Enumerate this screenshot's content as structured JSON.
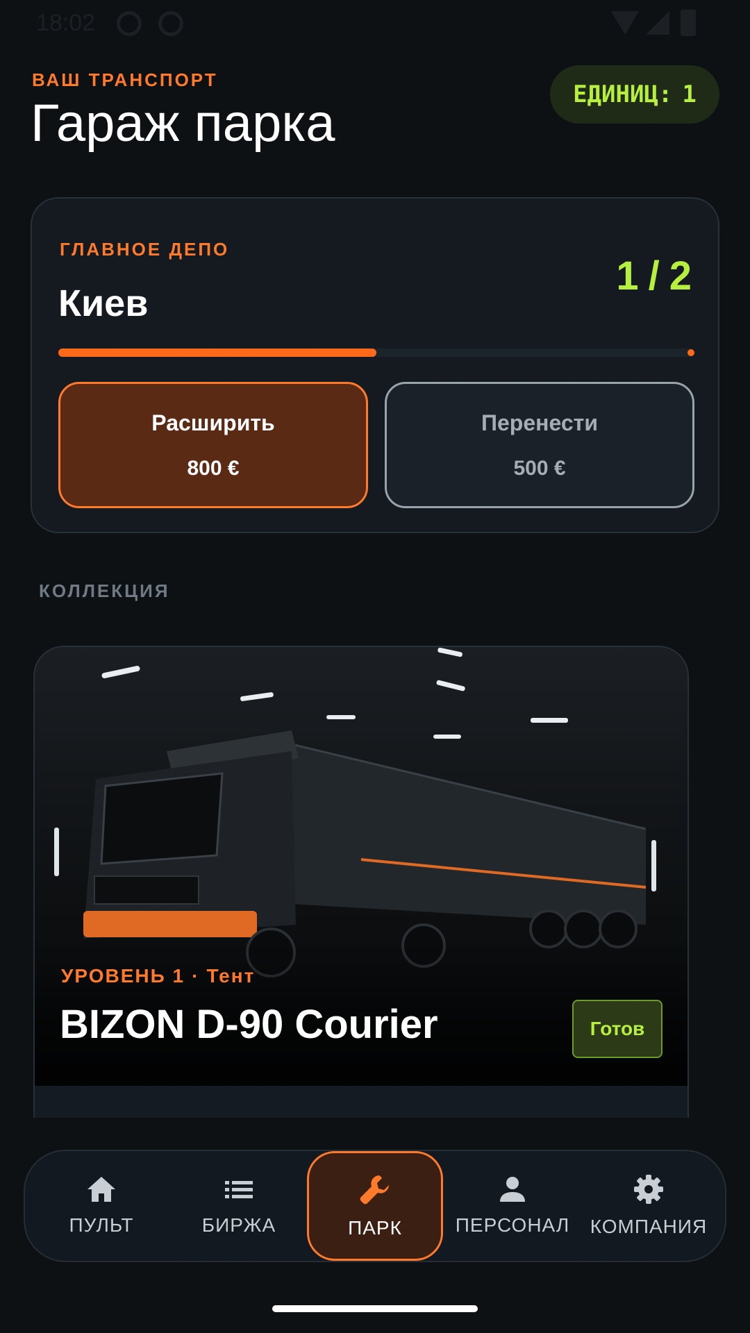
{
  "status_bar": {
    "time": "18:02"
  },
  "header": {
    "eyebrow": "ВАШ ТРАНСПОРТ",
    "title": "Гараж парка",
    "units_label": "ЕДИНИЦ:",
    "units_value": "1"
  },
  "depot": {
    "label": "ГЛАВНОЕ ДЕПО",
    "city": "Киев",
    "capacity_used": "1",
    "capacity_sep": "/",
    "capacity_total": "2",
    "progress_fraction": 0.5,
    "expand": {
      "label": "Расширить",
      "price": "800 €"
    },
    "move": {
      "label": "Перенести",
      "price": "500 €"
    }
  },
  "collection": {
    "label": "КОЛЛЕКЦИЯ",
    "vehicles": [
      {
        "level": "УРОВЕНЬ 1",
        "separator": "·",
        "type": "Тент",
        "name": "BIZON D-90 Courier",
        "status": "Готов"
      }
    ]
  },
  "nav": {
    "items": [
      {
        "label": "ПУЛЬТ",
        "icon": "home-icon"
      },
      {
        "label": "БИРЖА",
        "icon": "list-icon"
      },
      {
        "label": "ПАРК",
        "icon": "wrench-icon",
        "active": true
      },
      {
        "label": "ПЕРСОНАЛ",
        "icon": "person-icon"
      },
      {
        "label": "КОМПАНИЯ",
        "icon": "gear-icon"
      }
    ]
  },
  "colors": {
    "accent": "#ff7a2b",
    "lime": "#b6ef3e",
    "background": "#0e1114"
  }
}
